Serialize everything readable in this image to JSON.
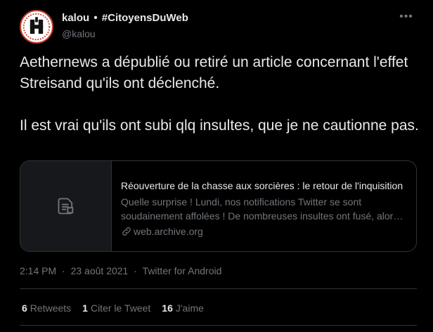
{
  "author": {
    "name": "kalou",
    "separator": "•",
    "hashtag": "#CitoyensDuWeb",
    "handle": "@kalou"
  },
  "icons": {
    "more": "more-horizontal-icon",
    "avatar": "avatar-logo",
    "card_placeholder": "document-icon",
    "link": "link-icon"
  },
  "tweet": {
    "paragraph_1": "Aethernews a dépublié ou retiré un article concernant l'effet Streisand qu'ils ont déclenché.",
    "paragraph_2": "Il est vrai qu'ils ont subi qlq insultes, que je ne cautionne pas."
  },
  "card": {
    "title": "Réouverture de la chasse aux sorcières : le retour de l'inquisition",
    "description": "Quelle surprise ! Lundi, nos notifications Twitter se sont soudainement affolées ! De nombreuses insultes ont fusé, alors que nous n'avions rien publié de particulier.",
    "domain": "web.archive.org"
  },
  "meta": {
    "time": "2:14 PM",
    "separator": "·",
    "date": "23 août 2021",
    "source": "Twitter for Android"
  },
  "stats": {
    "retweets_count": "6",
    "retweets_label": "Retweets",
    "quotes_count": "1",
    "quotes_label": "Citer le Tweet",
    "likes_count": "16",
    "likes_label": "J'aime"
  },
  "colors": {
    "background": "#000000",
    "text_primary": "#e7e9ea",
    "text_secondary": "#71767b",
    "border": "#2f3336",
    "avatar_ring": "#c0392b"
  }
}
